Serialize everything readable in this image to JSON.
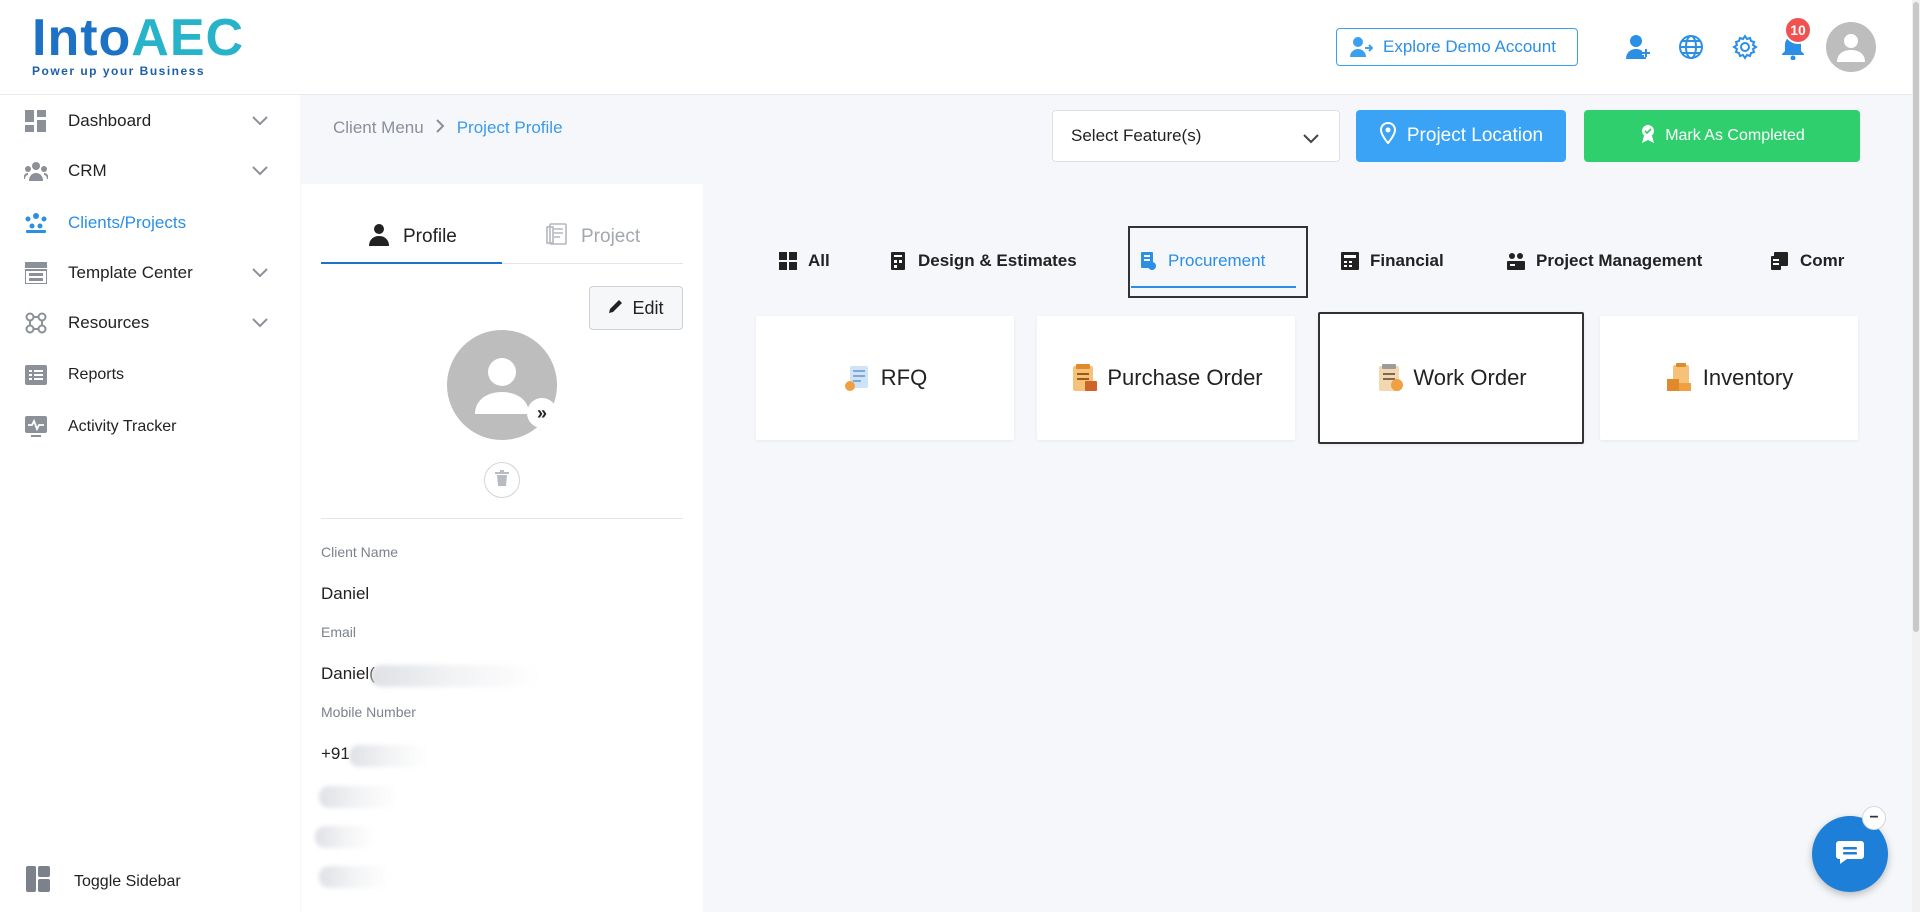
{
  "logo": {
    "name_main": "Into",
    "name_accent": "AEC",
    "tagline": "Power up your Business"
  },
  "header": {
    "demo_button": "Explore Demo Account",
    "notification_count": "10",
    "icons": [
      "add-user-icon",
      "globe-icon",
      "gear-icon",
      "bell-icon",
      "user-avatar-icon"
    ]
  },
  "sidebar": {
    "items": [
      {
        "label": "Dashboard",
        "icon": "dashboard-icon",
        "expandable": true
      },
      {
        "label": "CRM",
        "icon": "crm-icon",
        "expandable": true
      },
      {
        "label": "Clients/Projects",
        "icon": "clients-icon",
        "expandable": false,
        "active": true
      },
      {
        "label": "Template Center",
        "icon": "template-icon",
        "expandable": true
      },
      {
        "label": "Resources",
        "icon": "resources-icon",
        "expandable": true
      },
      {
        "label": "Reports",
        "icon": "reports-icon",
        "expandable": false
      },
      {
        "label": "Activity Tracker",
        "icon": "activity-icon",
        "expandable": false
      }
    ],
    "toggle_label": "Toggle Sidebar"
  },
  "breadcrumb": {
    "parent": "Client Menu",
    "current": "Project Profile"
  },
  "actions": {
    "select_feature_placeholder": "Select Feature(s)",
    "project_location": "Project Location",
    "mark_completed": "Mark As Completed"
  },
  "profile": {
    "tabs": [
      {
        "label": "Profile",
        "active": true
      },
      {
        "label": "Project",
        "active": false
      }
    ],
    "edit_label": "Edit",
    "expand_glyph": "»",
    "fields": {
      "client_name_label": "Client Name",
      "client_name_value": "Daniel",
      "email_label": "Email",
      "email_value": "Daniel(",
      "mobile_label": "Mobile Number",
      "mobile_value": "+91"
    }
  },
  "feature_tabs": [
    {
      "label": "All",
      "icon": "grid-icon"
    },
    {
      "label": "Design & Estimates",
      "icon": "design-icon"
    },
    {
      "label": "Procurement",
      "icon": "procurement-icon",
      "active": true
    },
    {
      "label": "Financial",
      "icon": "financial-icon"
    },
    {
      "label": "Project Management",
      "icon": "project-management-icon"
    },
    {
      "label": "Comr",
      "icon": "communication-icon"
    }
  ],
  "cards": [
    {
      "label": "RFQ",
      "icon": "rfq-icon"
    },
    {
      "label": "Purchase Order",
      "icon": "purchase-order-icon"
    },
    {
      "label": "Work Order",
      "icon": "work-order-icon",
      "focused": true
    },
    {
      "label": "Inventory",
      "icon": "inventory-icon"
    }
  ],
  "chat": {
    "minimize_glyph": "−"
  },
  "colors": {
    "primary": "#2b8fe6",
    "success": "#2ecf6c",
    "danger": "#f05252",
    "background": "#f5f7fb"
  }
}
